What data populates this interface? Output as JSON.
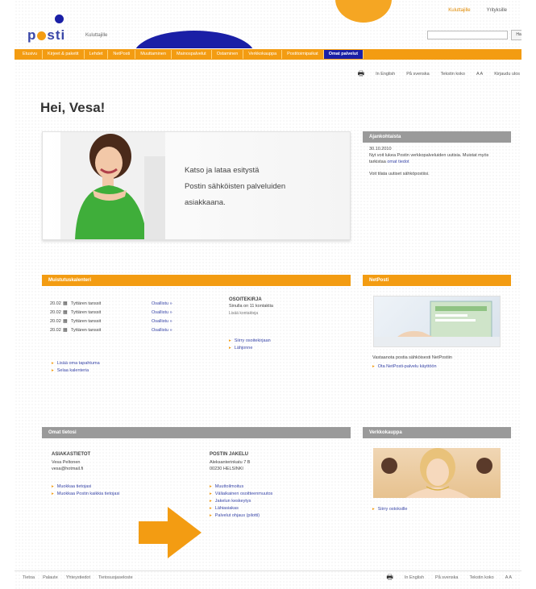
{
  "header": {
    "logo_text": "p sti",
    "tagline": "Kuluttajille",
    "top_links": [
      "Kuluttajille",
      "Yrityksille"
    ],
    "search_placeholder": "",
    "search_button": "Hae"
  },
  "nav": {
    "items": [
      "Etusivu",
      "Kirjeet & paketit",
      "Lehdet",
      "NetPosti",
      "Muuttaminen",
      "Mainospalvelut",
      "Ostaminen",
      "Verkkokauppa",
      "Postitoimipaikat",
      "Omat palvelut"
    ]
  },
  "utility": {
    "items": [
      "In English",
      "På svenska",
      "Tekstin koko",
      "Kirjaudu ulos"
    ]
  },
  "greeting": "Hei, Vesa!",
  "hero": {
    "line1": "Katso ja lataa esitystä",
    "line2": "Postin sähköisten palveluiden",
    "line3": "asiakkaana."
  },
  "news": {
    "title": "Ajankohtaista",
    "date": "30.10.2010",
    "text1": "Nyt voit lukea Postin verkkopalveluiden uutisia. Muistat myös tarkistaa",
    "link1": "omat tiedot",
    "text2": "Voit tilata uutiset sähköpostiisi."
  },
  "calendar": {
    "title": "Muistutuskalenteri",
    "events": [
      {
        "time": "20.02",
        "title": "Tyttären tanssit",
        "action": "Osallistu »"
      },
      {
        "time": "20.02",
        "title": "Tyttären tanssit",
        "action": "Osallistu »"
      },
      {
        "time": "20.02",
        "title": "Tyttären tanssit",
        "action": "Osallistu »"
      },
      {
        "time": "20.02",
        "title": "Tyttären tanssit",
        "action": "Osallistu »"
      }
    ],
    "side_title": "OSOITEKIRJA",
    "side_line": "Sinulla on 11 kontaktia",
    "side_sub": "Lisää kontakteja",
    "side_links": [
      "Siirry osoitekirjaan",
      "Lähjonne"
    ],
    "links": [
      "Lisää oma tapahtuma",
      "Selaa kalenteria"
    ]
  },
  "netpost": {
    "title": "NetPosti",
    "caption": "Vastaanota postia sähköisesti NetPostiin",
    "link": "Ota NetPosti-palvelu käyttöön"
  },
  "info": {
    "title": "Omat tietosi",
    "col1_head": "ASIAKASTIETOT",
    "col1_lines": [
      "Vesa Peltonen",
      "vesa@hotmail.fi"
    ],
    "col1_links": [
      "Muokkaa tietojasi",
      "Muokkaa Postin kaikkia tietojasi"
    ],
    "col2_head": "POSTIN JAKELU",
    "col2_lines": [
      "Aleksanterinkatu 7 B",
      "00230 HELSINKI"
    ],
    "col2_links": [
      "Muuttoilmoitus",
      "Väliaikainen osoitteenmuutos",
      "Jakelun keskeytys",
      "Lähiasiakas",
      "Palvelut ohjaus (pilotti)"
    ]
  },
  "webshop": {
    "title": "Verkkokauppa",
    "link": "Siirry ostoksille"
  },
  "footer": {
    "left_links": [
      "Tietoa",
      "Palaute",
      "Yhteystiedot",
      "Tietosuojaseloste"
    ],
    "right_links": [
      "In English",
      "På svenska",
      "Tekstin koko"
    ]
  }
}
